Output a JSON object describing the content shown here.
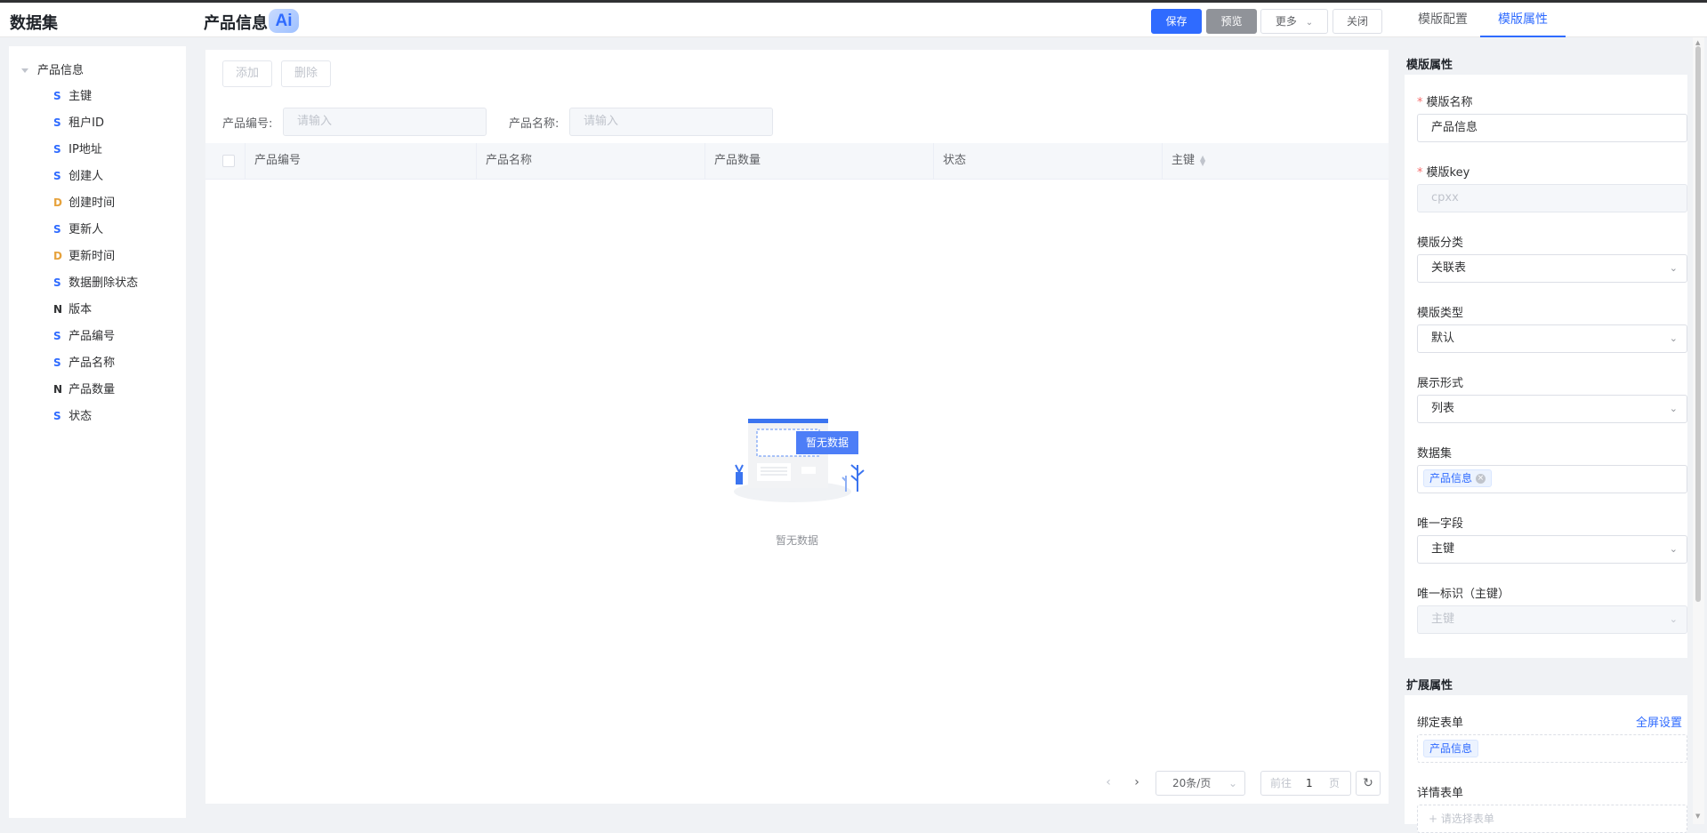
{
  "header": {
    "dataset_title": "数据集",
    "page_title": "产品信息",
    "ai_badge": "Ai",
    "save": "保存",
    "preview": "预览",
    "more": "更多",
    "close": "关闭",
    "tab_config": "模版配置",
    "tab_props": "模版属性"
  },
  "tree": {
    "root": "产品信息",
    "items": [
      {
        "type": "S",
        "label": "主键"
      },
      {
        "type": "S",
        "label": "租户ID"
      },
      {
        "type": "S",
        "label": "IP地址"
      },
      {
        "type": "S",
        "label": "创建人"
      },
      {
        "type": "D",
        "label": "创建时间"
      },
      {
        "type": "S",
        "label": "更新人"
      },
      {
        "type": "D",
        "label": "更新时间"
      },
      {
        "type": "S",
        "label": "数据删除状态"
      },
      {
        "type": "N",
        "label": "版本"
      },
      {
        "type": "S",
        "label": "产品编号"
      },
      {
        "type": "S",
        "label": "产品名称"
      },
      {
        "type": "N",
        "label": "产品数量"
      },
      {
        "type": "S",
        "label": "状态"
      }
    ]
  },
  "main": {
    "add": "添加",
    "delete": "删除",
    "filter1_label": "产品编号:",
    "filter1_placeholder": "请输入",
    "filter2_label": "产品名称:",
    "filter2_placeholder": "请输入",
    "columns": [
      "产品编号",
      "产品名称",
      "产品数量",
      "状态",
      "主键"
    ],
    "empty_badge": "暂无数据",
    "empty_text": "暂无数据",
    "page_size": "20条/页",
    "goto_prefix": "前往",
    "goto_page": "1",
    "goto_suffix": "页"
  },
  "props": {
    "section_title": "模版属性",
    "name_label": "模版名称",
    "name_value": "产品信息",
    "key_label": "模版key",
    "key_value": "cpxx",
    "category_label": "模版分类",
    "category_value": "关联表",
    "type_label": "模版类型",
    "type_value": "默认",
    "display_label": "展示形式",
    "display_value": "列表",
    "dataset_label": "数据集",
    "dataset_tag": "产品信息",
    "unique_field_label": "唯一字段",
    "unique_field_value": "主键",
    "unique_id_label": "唯一标识（主键）",
    "unique_id_value": "主键"
  },
  "ext": {
    "section_title": "扩展属性",
    "bind_form_label": "绑定表单",
    "fullscreen_link": "全屏设置",
    "bind_form_tag": "产品信息",
    "detail_form_label": "详情表单",
    "detail_form_placeholder": "请选择表单"
  },
  "colors": {
    "primary": "#2f6bff",
    "preview_gray": "#909399",
    "type_S": "#2f6bff",
    "type_D": "#e6a23c"
  }
}
